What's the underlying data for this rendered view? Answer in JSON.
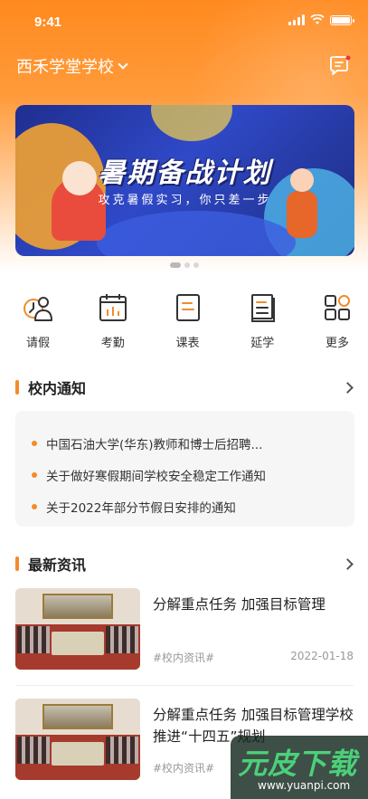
{
  "status_bar": {
    "time": "9:41"
  },
  "header": {
    "school_name": "西禾学堂学校"
  },
  "banner": {
    "title": "暑期备战计划",
    "subtitle": "攻克暑假实习，你只差一步",
    "page_count": 3,
    "active_page": 1
  },
  "menu": {
    "items": [
      {
        "label": "请假",
        "icon": "leave-icon"
      },
      {
        "label": "考勤",
        "icon": "attendance-calendar-icon"
      },
      {
        "label": "课表",
        "icon": "timetable-icon"
      },
      {
        "label": "延学",
        "icon": "book-icon"
      },
      {
        "label": "更多",
        "icon": "more-grid-icon"
      }
    ]
  },
  "notices": {
    "title": "校内通知",
    "items": [
      "中国石油大学(华东)教师和博士后招聘...",
      "关于做好寒假期间学校安全稳定工作通知",
      "关于2022年部分节假日安排的通知"
    ]
  },
  "news": {
    "title": "最新资讯",
    "items": [
      {
        "title": "分解重点任务 加强目标管理",
        "tag": "#校内资讯#",
        "date": "2022-01-18"
      },
      {
        "title": "分解重点任务 加强目标管理学校推进“十四五”规划",
        "tag": "#校内资讯#",
        "date": ""
      }
    ]
  },
  "watermark": {
    "main": "元皮下载",
    "sub": "www.yuanpi.com"
  },
  "colors": {
    "accent": "#f28b2c",
    "header_orange": "#ff8a1f",
    "banner_blue": "#2f49c8"
  }
}
